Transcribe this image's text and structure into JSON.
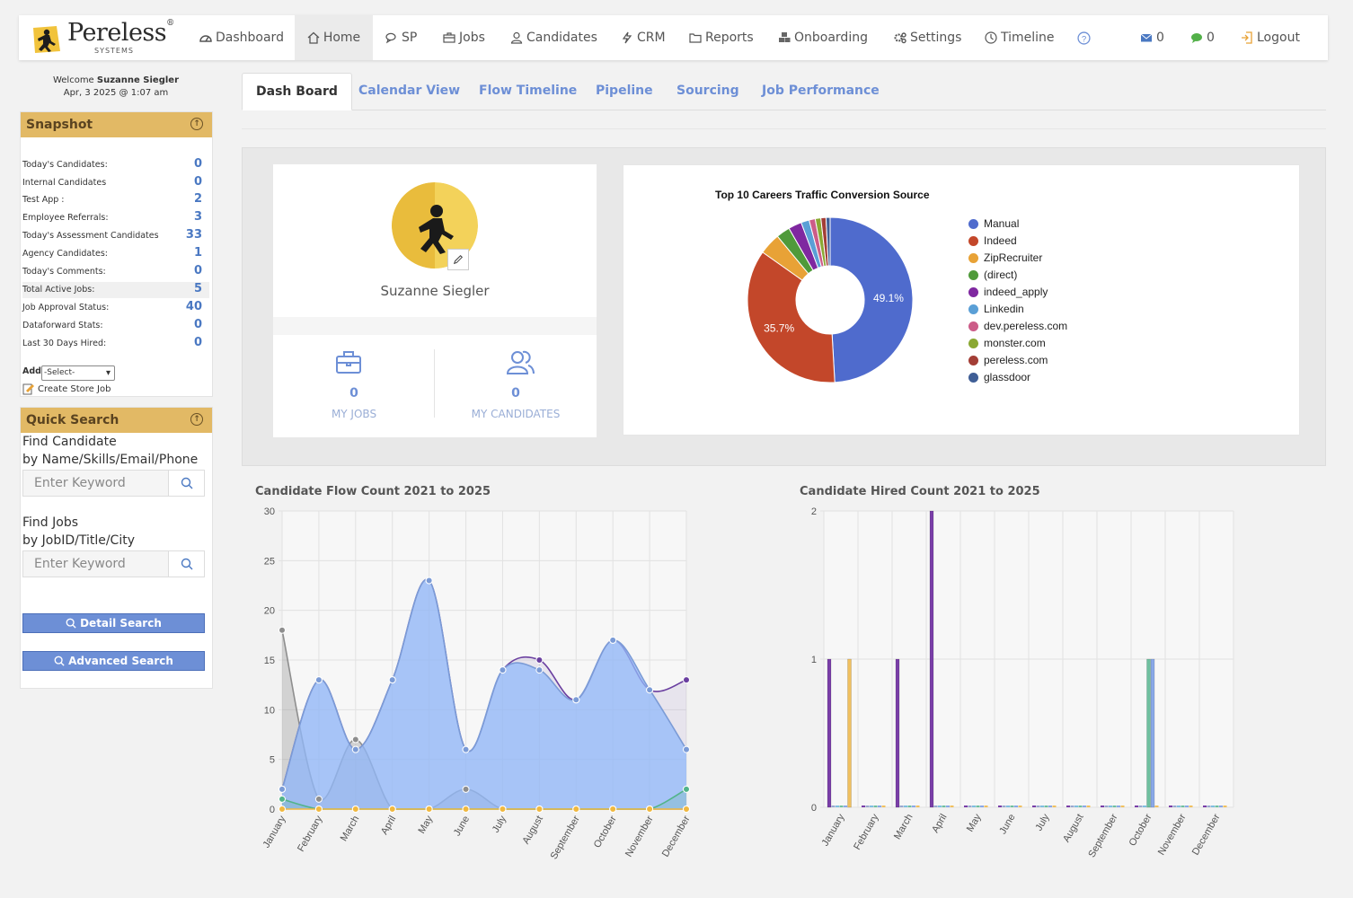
{
  "nav": {
    "brand": "Pereless",
    "brand_sub": "SYSTEMS",
    "items": [
      {
        "label": "Dashboard"
      },
      {
        "label": "Home"
      },
      {
        "label": "SP"
      },
      {
        "label": "Jobs"
      },
      {
        "label": "Candidates"
      },
      {
        "label": "CRM"
      },
      {
        "label": "Reports"
      },
      {
        "label": "Onboarding"
      },
      {
        "label": "Settings"
      },
      {
        "label": "Timeline"
      }
    ],
    "mail_count": "0",
    "chat_count": "0",
    "logout": "Logout"
  },
  "welcome": {
    "prefix": "Welcome",
    "user": "Suzanne Siegler",
    "datetime": "Apr, 3 2025 @ 1:07 am"
  },
  "snapshot": {
    "title": "Snapshot",
    "rows": [
      {
        "label": "Today's Candidates:",
        "value": "0"
      },
      {
        "label": "Internal Candidates",
        "value": "0"
      },
      {
        "label": "Test App :",
        "value": "2"
      },
      {
        "label": "Employee Referrals:",
        "value": "3"
      },
      {
        "label": "Today's Assessment Candidates",
        "value": "33"
      },
      {
        "label": "Agency Candidates:",
        "value": "1"
      },
      {
        "label": "Today's Comments:",
        "value": "0"
      },
      {
        "label": "Total Active Jobs:",
        "value": "5"
      },
      {
        "label": "Job Approval Status:",
        "value": "40"
      },
      {
        "label": "Dataforward Stats:",
        "value": "0"
      },
      {
        "label": "Last 30 Days Hired:",
        "value": "0"
      }
    ],
    "add_label": "Add",
    "add_select": "-Select-",
    "create_store_job": "Create Store Job"
  },
  "quick_search": {
    "title": "Quick Search",
    "find_candidate_1": "Find Candidate",
    "find_candidate_2": "by Name/Skills/Email/Phone",
    "candidate_placeholder": "Enter Keyword",
    "find_jobs_1": "Find Jobs",
    "find_jobs_2": "by JobID/Title/City",
    "jobs_placeholder": "Enter Keyword",
    "detail_search": "Detail Search",
    "advanced_search": "Advanced Search"
  },
  "tabs": [
    {
      "label": "Dash Board",
      "active": true
    },
    {
      "label": "Calendar View"
    },
    {
      "label": "Flow Timeline"
    },
    {
      "label": "Pipeline"
    },
    {
      "label": "Sourcing"
    },
    {
      "label": "Job Performance"
    }
  ],
  "profile": {
    "name": "Suzanne Siegler",
    "my_jobs_count": "0",
    "my_jobs_label": "MY JOBS",
    "my_candidates_count": "0",
    "my_candidates_label": "MY CANDIDATES"
  },
  "chart_data": [
    {
      "type": "pie",
      "title": "Top 10 Careers Traffic Conversion Source",
      "slices": [
        {
          "label": "Manual",
          "value": 49.1,
          "color": "#4f6bcd",
          "pct_label": "49.1%"
        },
        {
          "label": "Indeed",
          "value": 35.7,
          "color": "#c3472a",
          "pct_label": "35.7%"
        },
        {
          "label": "ZipRecruiter",
          "value": 4.2,
          "color": "#e8a236"
        },
        {
          "label": "(direct)",
          "value": 2.7,
          "color": "#4f9a3a"
        },
        {
          "label": "indeed_apply",
          "value": 2.6,
          "color": "#7f28a0"
        },
        {
          "label": "Linkedin",
          "value": 1.6,
          "color": "#5a9fd6"
        },
        {
          "label": "dev.pereless.com",
          "value": 1.2,
          "color": "#cc5c88"
        },
        {
          "label": "monster.com",
          "value": 1.1,
          "color": "#8aa832"
        },
        {
          "label": "pereless.com",
          "value": 1.0,
          "color": "#a33e36"
        },
        {
          "label": "glassdoor",
          "value": 0.8,
          "color": "#3f5e96"
        }
      ]
    },
    {
      "type": "area",
      "title": "Candidate Flow Count 2021 to 2025",
      "categories": [
        "January",
        "February",
        "March",
        "April",
        "May",
        "June",
        "July",
        "August",
        "September",
        "October",
        "November",
        "December"
      ],
      "ylim": [
        0,
        30
      ],
      "yticks": [
        0,
        5,
        10,
        15,
        20,
        25,
        30
      ],
      "series": [
        {
          "values": [
            18,
            1,
            7,
            0,
            0,
            2,
            0,
            0,
            0,
            0,
            0,
            0
          ],
          "color": "#8e8e8e",
          "fill": "rgba(140,140,140,0.35)"
        },
        {
          "values": [
            2,
            13,
            6,
            13,
            23,
            6,
            14,
            15,
            11,
            17,
            12,
            13
          ],
          "color": "#6a3fa0",
          "fill": "rgba(140,120,180,0.15)"
        },
        {
          "values": [
            2,
            13,
            6,
            13,
            23,
            6,
            14,
            14,
            11,
            17,
            12,
            6
          ],
          "color": "#7b9bd6",
          "fill": "rgba(145,185,250,0.75)"
        },
        {
          "values": [
            1,
            0,
            0,
            0,
            0,
            0,
            0,
            0,
            0,
            0,
            0,
            2
          ],
          "color": "#52b48a",
          "fill": "rgba(82,180,138,0.2)"
        },
        {
          "values": [
            0,
            0,
            0,
            0,
            0,
            0,
            0,
            0,
            0,
            0,
            0,
            0
          ],
          "color": "#f0b840",
          "fill": "rgba(240,184,64,0.3)"
        }
      ]
    },
    {
      "type": "bar",
      "title": "Candidate Hired Count 2021 to 2025",
      "categories": [
        "January",
        "February",
        "March",
        "April",
        "May",
        "June",
        "July",
        "August",
        "September",
        "October",
        "November",
        "December"
      ],
      "ylim": [
        0,
        2
      ],
      "yticks": [
        0,
        1,
        2
      ],
      "series": [
        {
          "values": [
            1,
            0,
            1,
            2,
            0,
            0,
            0,
            0,
            0,
            0,
            0,
            0
          ],
          "color": "#7a3fa8"
        },
        {
          "values": [
            0,
            0,
            0,
            0,
            0,
            0,
            0,
            0,
            0,
            0,
            0,
            0
          ],
          "color": "#9aa8d0"
        },
        {
          "values": [
            0,
            0,
            0,
            0,
            0,
            0,
            0,
            0,
            0,
            0,
            0,
            0
          ],
          "color": "#7fbfe0"
        },
        {
          "values": [
            0,
            0,
            0,
            0,
            0,
            0,
            0,
            0,
            0,
            1,
            0,
            0
          ],
          "color": "#6fc0a0"
        },
        {
          "values": [
            0,
            0,
            0,
            0,
            0,
            0,
            0,
            0,
            0,
            1,
            0,
            0
          ],
          "color": "#8aa8e8"
        },
        {
          "values": [
            1,
            0,
            0,
            0,
            0,
            0,
            0,
            0,
            0,
            0,
            0,
            0
          ],
          "color": "#f0c060"
        }
      ]
    }
  ]
}
